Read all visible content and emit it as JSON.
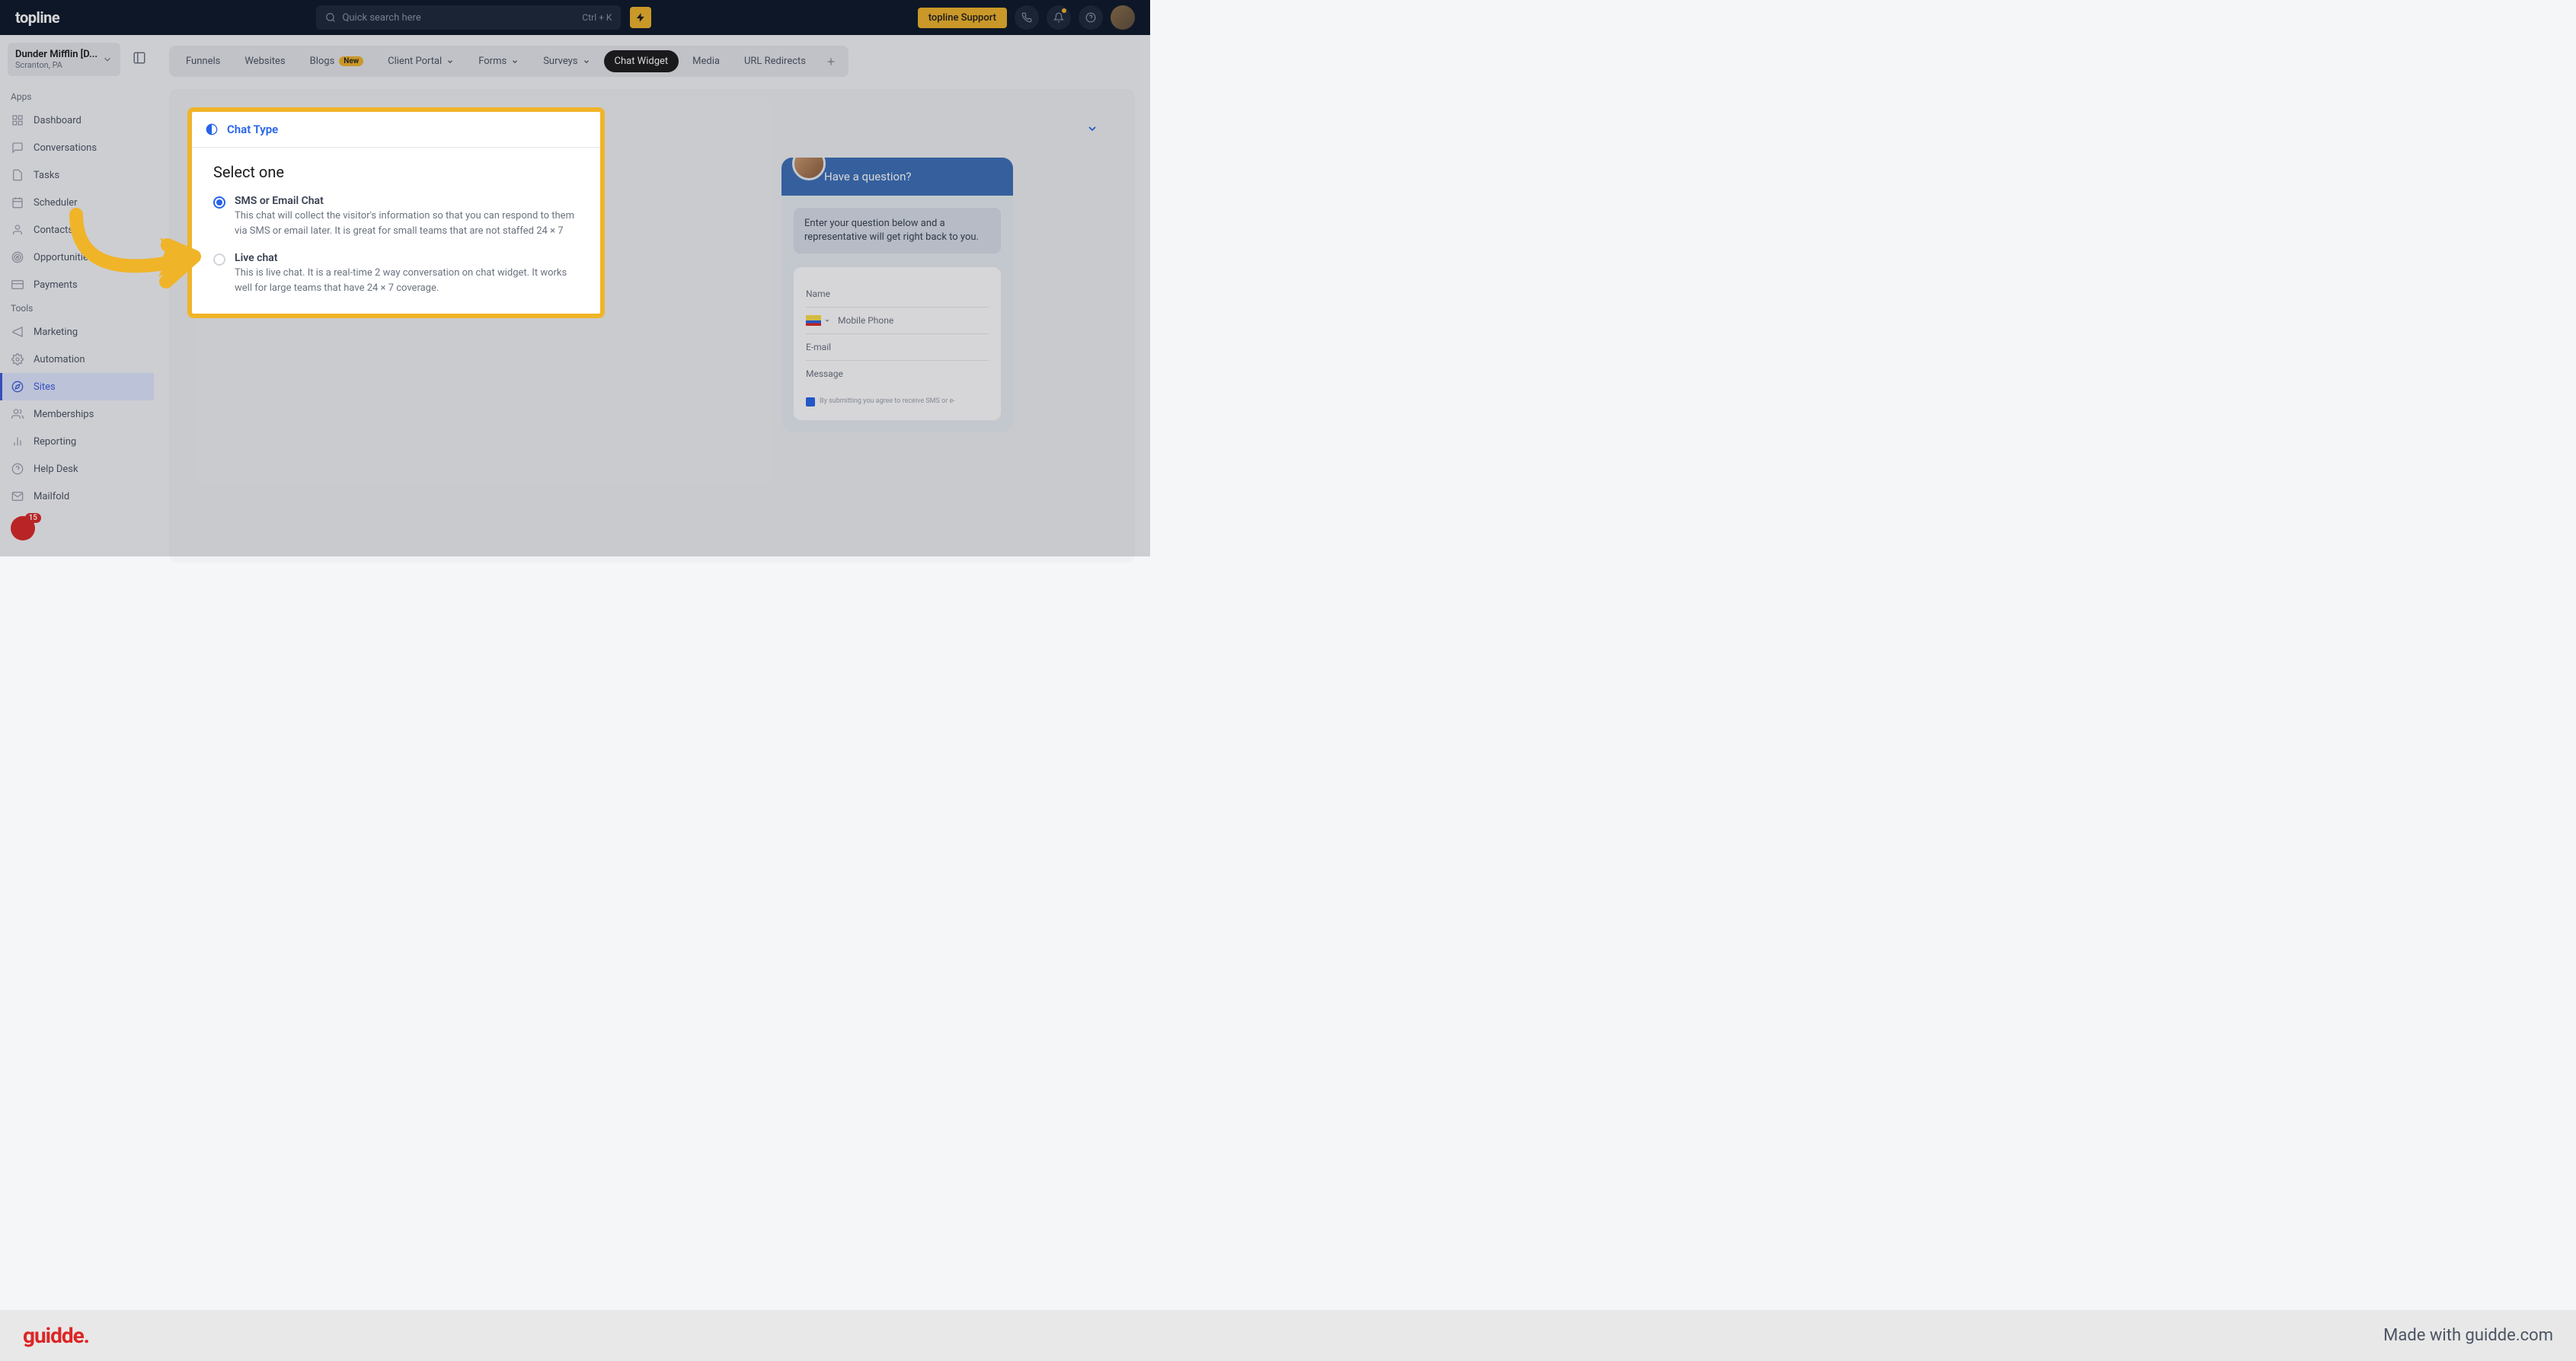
{
  "topbar": {
    "logo": "topline",
    "search_placeholder": "Quick search here",
    "kbd": "Ctrl + K",
    "support": "topline Support"
  },
  "account": {
    "name": "Dunder Mifflin [D...",
    "location": "Scranton, PA"
  },
  "sidebar": {
    "apps_label": "Apps",
    "tools_label": "Tools",
    "apps": [
      {
        "label": "Dashboard"
      },
      {
        "label": "Conversations"
      },
      {
        "label": "Tasks"
      },
      {
        "label": "Scheduler"
      },
      {
        "label": "Contacts"
      },
      {
        "label": "Opportunities"
      },
      {
        "label": "Payments"
      }
    ],
    "tools": [
      {
        "label": "Marketing"
      },
      {
        "label": "Automation"
      },
      {
        "label": "Sites"
      },
      {
        "label": "Memberships"
      },
      {
        "label": "Reporting"
      },
      {
        "label": "Help Desk"
      },
      {
        "label": "Mailfold"
      }
    ],
    "badge_count": "15"
  },
  "tabs": {
    "items": [
      {
        "label": "Funnels"
      },
      {
        "label": "Websites"
      },
      {
        "label": "Blogs",
        "badge": "New"
      },
      {
        "label": "Client Portal",
        "dropdown": true
      },
      {
        "label": "Forms",
        "dropdown": true
      },
      {
        "label": "Surveys",
        "dropdown": true
      },
      {
        "label": "Chat Widget",
        "active": true
      },
      {
        "label": "Media"
      },
      {
        "label": "URL Redirects"
      }
    ]
  },
  "chat_type": {
    "title": "Chat Type",
    "heading": "Select one",
    "options": [
      {
        "label": "SMS or Email Chat",
        "desc": "This chat will collect the visitor's information so that you can respond to them via SMS or email later. It is great for small teams that are not staffed 24 × 7",
        "checked": true
      },
      {
        "label": "Live chat",
        "desc": "This is live chat. It is a real-time 2 way conversation on chat widget. It works well for large teams that have 24 × 7 coverage.",
        "checked": false
      }
    ]
  },
  "chat_preview": {
    "header": "Have a question?",
    "bubble": "Enter your question below and a representative will get right back to you.",
    "fields": {
      "name": "Name",
      "phone": "Mobile Phone",
      "email": "E-mail",
      "message": "Message"
    },
    "consent": "By submitting you agree to receive SMS or e-"
  },
  "footer": {
    "logo": "guidde.",
    "text": "Made with guidde.com"
  }
}
